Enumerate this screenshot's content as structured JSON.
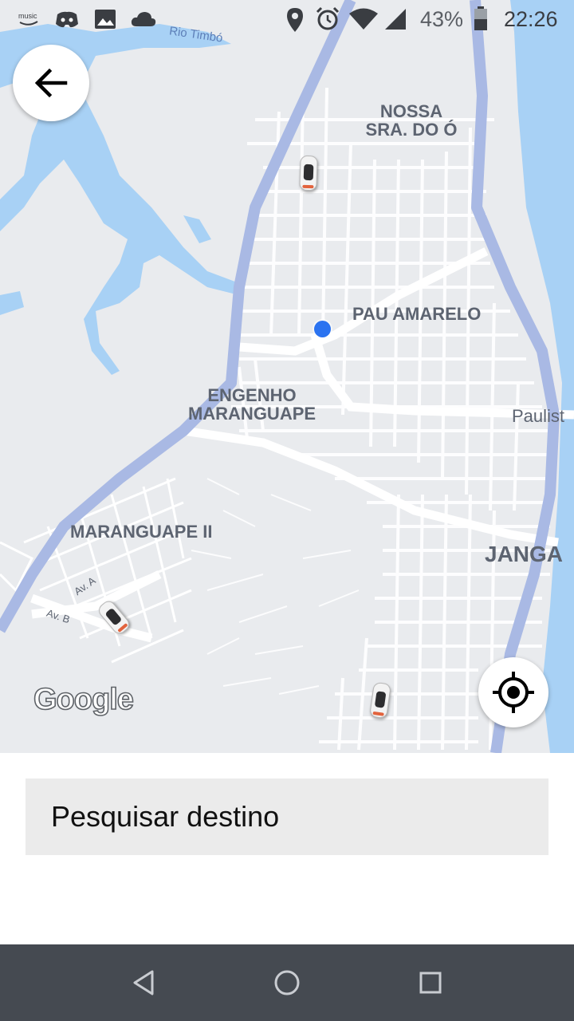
{
  "status_bar": {
    "battery_percent": "43%",
    "time": "22:26",
    "icons": [
      "amazon-music-icon",
      "discord-icon",
      "image-icon",
      "cloud-icon",
      "location-icon",
      "alarm-icon",
      "wifi-icon",
      "signal-icon",
      "battery-icon"
    ]
  },
  "map": {
    "labels": {
      "river": "Rio Timbó",
      "nossa_sra_do_o": "NOSSA\nSRA. DO Ó",
      "pau_amarelo": "PAU AMARELO",
      "engenho_maranguape": "ENGENHO\nMARANGUAPE",
      "paulista": "Paulist",
      "maranguape_ii": "MARANGUAPE II",
      "janga": "JANGA",
      "av_a": "Av. A",
      "av_b": "Av. B"
    },
    "attribution": "Google",
    "colors": {
      "land": "#e9ebee",
      "water": "#a8d1f5",
      "highway": "#a9b9e4",
      "streets": "#ffffff",
      "user_location": "#2b73f0"
    }
  },
  "controls": {
    "back_icon": "arrow-left-icon",
    "locate_icon": "crosshair-icon"
  },
  "search": {
    "placeholder": "Pesquisar destino"
  },
  "nav_bar": {
    "icons": [
      "back-triangle-icon",
      "home-circle-icon",
      "recents-square-icon"
    ]
  }
}
